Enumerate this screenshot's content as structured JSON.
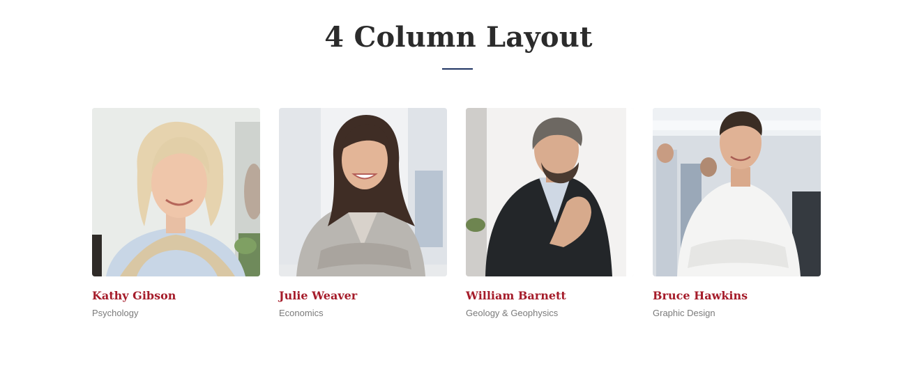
{
  "section": {
    "title": "4 Column Layout"
  },
  "colors": {
    "heading": "#2b2b2b",
    "divider": "#1f3463",
    "name": "#a51c2a",
    "department": "#7a7a7a"
  },
  "members": [
    {
      "name": "Kathy Gibson",
      "department": "Psychology",
      "photo_icon": "portrait-photo"
    },
    {
      "name": "Julie Weaver",
      "department": "Economics",
      "photo_icon": "portrait-photo"
    },
    {
      "name": "William Barnett",
      "department": "Geology & Geophysics",
      "photo_icon": "portrait-photo"
    },
    {
      "name": "Bruce Hawkins",
      "department": "Graphic Design",
      "photo_icon": "portrait-photo"
    }
  ]
}
